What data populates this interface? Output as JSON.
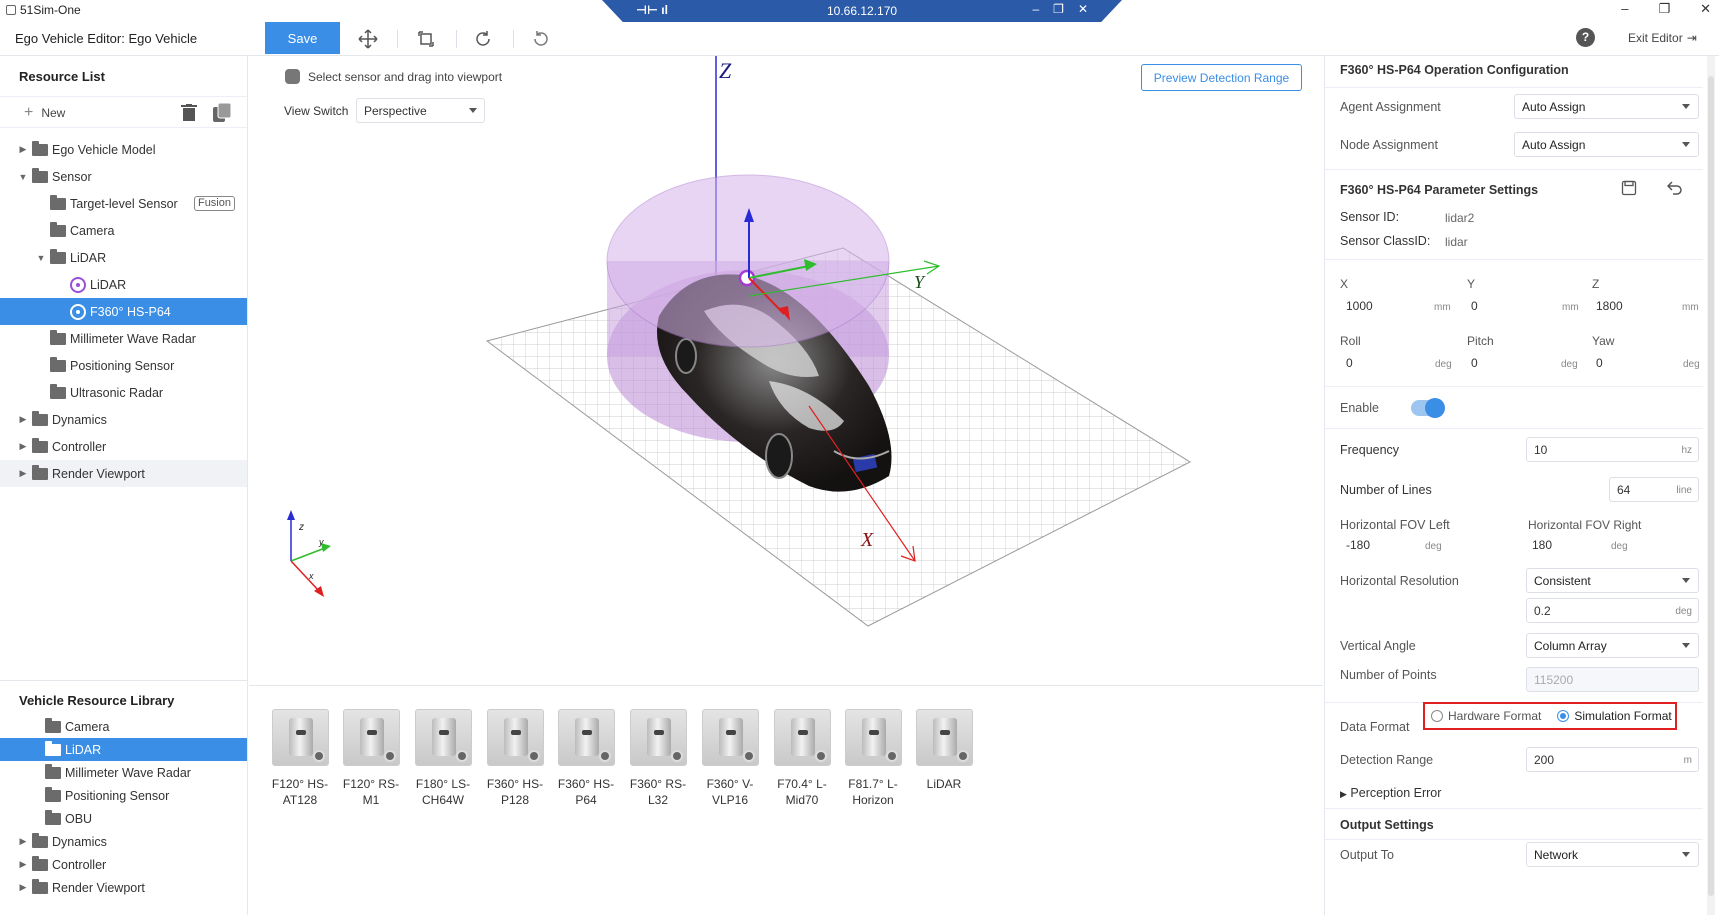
{
  "window": {
    "app_name": "51Sim-One",
    "remote_ip": "10.66.12.170"
  },
  "header": {
    "editor_title": "Ego Vehicle Editor: Ego Vehicle",
    "save_label": "Save",
    "exit_label": "Exit Editor",
    "help_glyph": "?"
  },
  "resource_list": {
    "title": "Resource List",
    "new_label": "New",
    "items": [
      {
        "label": "Ego Vehicle Model",
        "fusion": ""
      },
      {
        "label": "Sensor"
      },
      {
        "label": "Target-level Sensor",
        "badge": "Fusion"
      },
      {
        "label": "Camera"
      },
      {
        "label": "LiDAR"
      },
      {
        "label": "LiDAR"
      },
      {
        "label": "F360° HS-P64"
      },
      {
        "label": "Millimeter Wave Radar"
      },
      {
        "label": "Positioning Sensor"
      },
      {
        "label": "Ultrasonic Radar"
      },
      {
        "label": "Dynamics"
      },
      {
        "label": "Controller"
      },
      {
        "label": "Render Viewport"
      }
    ]
  },
  "vehicle_library": {
    "title": "Vehicle Resource Library",
    "items": [
      {
        "label": "Camera"
      },
      {
        "label": "LiDAR"
      },
      {
        "label": "Millimeter Wave Radar"
      },
      {
        "label": "Positioning Sensor"
      },
      {
        "label": "OBU"
      },
      {
        "label": "Dynamics"
      },
      {
        "label": "Controller"
      },
      {
        "label": "Render Viewport"
      }
    ]
  },
  "viewport": {
    "hint": "Select sensor and drag into viewport",
    "view_switch_label": "View Switch",
    "view_switch_value": "Perspective",
    "preview_button": "Preview Detection Range",
    "axis_labels": {
      "z": "z",
      "y": "y",
      "x": "x",
      "big_z": "Z",
      "big_y": "Y",
      "big_x": "X"
    }
  },
  "sensor_cards": [
    {
      "line1": "F120° HS-",
      "line2": "AT128"
    },
    {
      "line1": "F120° RS-",
      "line2": "M1"
    },
    {
      "line1": "F180° LS-",
      "line2": "CH64W"
    },
    {
      "line1": "F360° HS-",
      "line2": "P128"
    },
    {
      "line1": "F360° HS-",
      "line2": "P64"
    },
    {
      "line1": "F360° RS-",
      "line2": "L32"
    },
    {
      "line1": "F360° V-",
      "line2": "VLP16"
    },
    {
      "line1": "F70.4° L-",
      "line2": "Mid70"
    },
    {
      "line1": "F81.7° L-",
      "line2": "Horizon"
    },
    {
      "line1": "LiDAR",
      "line2": ""
    }
  ],
  "config": {
    "op_title": "F360° HS-P64 Operation Configuration",
    "agent_label": "Agent Assignment",
    "agent_value": "Auto Assign",
    "node_label": "Node Assignment",
    "node_value": "Auto Assign",
    "param_title": "F360° HS-P64 Parameter Settings",
    "sensor_id_label": "Sensor ID:",
    "sensor_id_value": "lidar2",
    "sensor_class_label": "Sensor ClassID:",
    "sensor_class_value": "lidar",
    "x_label": "X",
    "x_value": "1000",
    "x_unit": "mm",
    "y_label": "Y",
    "y_value": "0",
    "y_unit": "mm",
    "z_label": "Z",
    "z_value": "1800",
    "z_unit": "mm",
    "roll_label": "Roll",
    "roll_value": "0",
    "roll_unit": "deg",
    "pitch_label": "Pitch",
    "pitch_value": "0",
    "pitch_unit": "deg",
    "yaw_label": "Yaw",
    "yaw_value": "0",
    "yaw_unit": "deg",
    "enable_label": "Enable",
    "enabled": true,
    "frequency_label": "Frequency",
    "frequency_value": "10",
    "frequency_unit": "hz",
    "lines_label": "Number of Lines",
    "lines_value": "64",
    "lines_unit": "line",
    "fov_left_label": "Horizontal FOV Left",
    "fov_left_value": "-180",
    "fov_left_unit": "deg",
    "fov_right_label": "Horizontal FOV Right",
    "fov_right_value": "180",
    "fov_right_unit": "deg",
    "h_res_label": "Horizontal Resolution",
    "h_res_mode": "Consistent",
    "h_res_value": "0.2",
    "h_res_unit": "deg",
    "v_angle_label": "Vertical Angle",
    "v_angle_value": "Column Array",
    "points_label": "Number of Points",
    "points_value": "115200",
    "data_format_label": "Data Format",
    "hardware_format": "Hardware Format",
    "simulation_format": "Simulation Format",
    "selected_format": "Simulation Format",
    "range_label": "Detection Range",
    "range_value": "200",
    "range_unit": "m",
    "perception_error": "Perception Error",
    "output_title": "Output Settings",
    "output_label": "Output To",
    "output_value": "Network"
  },
  "colors": {
    "accent": "#3a8ee6",
    "highlight_border": "#e02020",
    "sensor_purple": "#9b4fd6"
  }
}
